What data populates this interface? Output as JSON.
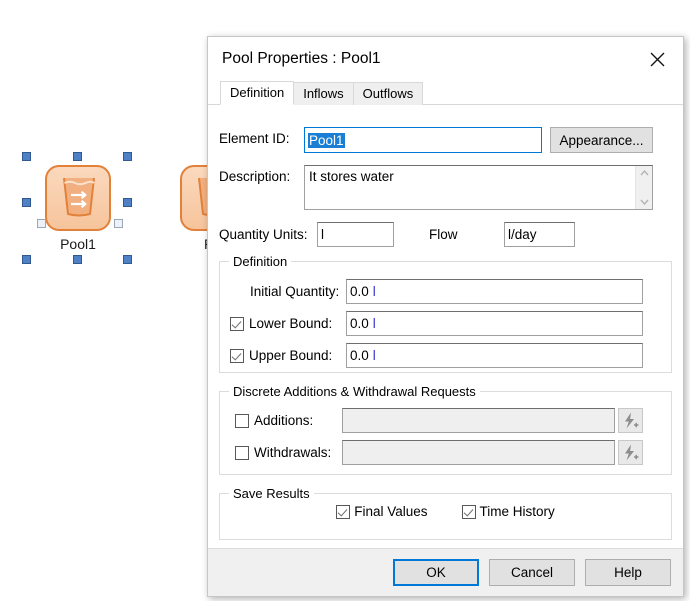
{
  "canvas": {
    "elements": [
      {
        "name": "pool-element",
        "label": "Pool1",
        "icon": "pool-icon",
        "selected": true
      },
      {
        "name": "reservoir-element",
        "label": "Re",
        "icon": "pool-icon",
        "selected": false
      }
    ]
  },
  "dialog": {
    "title": "Pool Properties : Pool1",
    "close_icon": "close-icon",
    "tabs": [
      {
        "label": "Definition",
        "active": true
      },
      {
        "label": "Inflows",
        "active": false
      },
      {
        "label": "Outflows",
        "active": false
      }
    ],
    "element_id": {
      "label": "Element ID:",
      "value": "Pool1",
      "selected": true
    },
    "appearance_button": "Appearance...",
    "description": {
      "label": "Description:",
      "value": "It stores water"
    },
    "quantity_units": {
      "label": "Quantity Units:",
      "value": "l"
    },
    "flow": {
      "label": "Flow",
      "value": "l/day"
    },
    "definition_group": {
      "caption": "Definition",
      "initial_quantity": {
        "label": "Initial Quantity:",
        "value": "0.0",
        "unit": "l"
      },
      "lower_bound": {
        "label": "Lower Bound:",
        "value": "0.0",
        "unit": "l",
        "checked": true
      },
      "upper_bound": {
        "label": "Upper Bound:",
        "value": "0.0",
        "unit": "l",
        "checked": true
      }
    },
    "discrete_group": {
      "caption": "Discrete Additions & Withdrawal Requests",
      "additions": {
        "label": "Additions:",
        "value": "",
        "checked": false,
        "button_icon": "lightning-plus-icon"
      },
      "withdrawals": {
        "label": "Withdrawals:",
        "value": "",
        "checked": false,
        "button_icon": "lightning-plus-icon"
      }
    },
    "save_results_group": {
      "caption": "Save Results",
      "final_values": {
        "label": "Final Values",
        "checked": true
      },
      "time_history": {
        "label": "Time History",
        "checked": true
      }
    },
    "footer": {
      "ok": "OK",
      "cancel": "Cancel",
      "help": "Help"
    }
  },
  "colors": {
    "accent": "#0078d7",
    "selection": "#1a7fd4",
    "unit_text": "#3333cc",
    "element_orange": "#e2813a",
    "handle_blue": "#4f81c7"
  }
}
